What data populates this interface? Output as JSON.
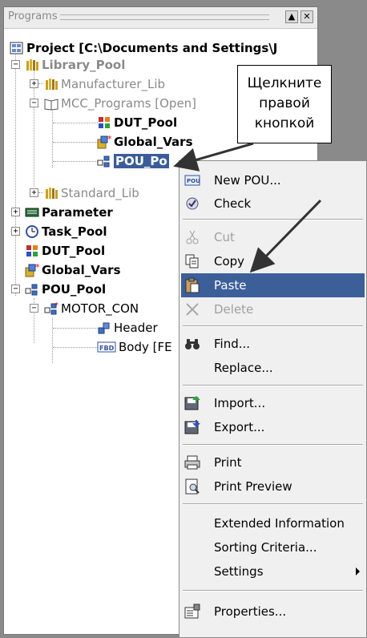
{
  "window": {
    "title": "Programs"
  },
  "tree": {
    "project": "Project [C:\\Documents and Settings\\J",
    "library_pool": "Library_Pool",
    "manufacturer_lib": "Manufacturer_Lib",
    "mcc_programs": "MCC_Programs [Open]",
    "dut_pool_child": "DUT_Pool",
    "global_vars_child": "Global_Vars",
    "pou_pool_child": "POU_Po",
    "standard_lib": "Standard_Lib",
    "parameter": "Parameter",
    "task_pool": "Task_Pool",
    "dut_pool": "DUT_Pool",
    "global_vars": "Global_Vars",
    "pou_pool": "POU_Pool",
    "motor_con": "MOTOR_CON",
    "header": "Header",
    "body": "Body [FE"
  },
  "callout": {
    "lines": [
      "Щелкните",
      "правой",
      "кнопкой"
    ]
  },
  "context_menu": {
    "items": [
      {
        "label": "New POU...",
        "icon": "new-pou-icon",
        "enabled": true
      },
      {
        "label": "Check",
        "icon": "check-icon",
        "enabled": true
      },
      {
        "label": "Cut",
        "icon": "scissors-icon",
        "enabled": false
      },
      {
        "label": "Copy",
        "icon": "copy-icon",
        "enabled": true
      },
      {
        "label": "Paste",
        "icon": "paste-icon",
        "enabled": true,
        "highlighted": true
      },
      {
        "label": "Delete",
        "icon": "delete-icon",
        "enabled": false
      },
      {
        "label": "Find...",
        "icon": "binoculars-icon",
        "enabled": true
      },
      {
        "label": "Replace...",
        "icon": "",
        "enabled": true
      },
      {
        "label": "Import...",
        "icon": "import-icon",
        "enabled": true
      },
      {
        "label": "Export...",
        "icon": "export-icon",
        "enabled": true
      },
      {
        "label": "Print",
        "icon": "printer-icon",
        "enabled": true
      },
      {
        "label": "Print Preview",
        "icon": "print-preview-icon",
        "enabled": true
      },
      {
        "label": "Extended Information",
        "icon": "",
        "enabled": true
      },
      {
        "label": "Sorting Criteria...",
        "icon": "",
        "enabled": true
      },
      {
        "label": "Settings",
        "icon": "",
        "enabled": true,
        "submenu": true
      },
      {
        "label": "Properties...",
        "icon": "properties-icon",
        "enabled": true
      }
    ]
  },
  "colors": {
    "selection": "#3a5d9a",
    "menu_bg": "#f0f0f0",
    "background": "#8a8a8a"
  }
}
